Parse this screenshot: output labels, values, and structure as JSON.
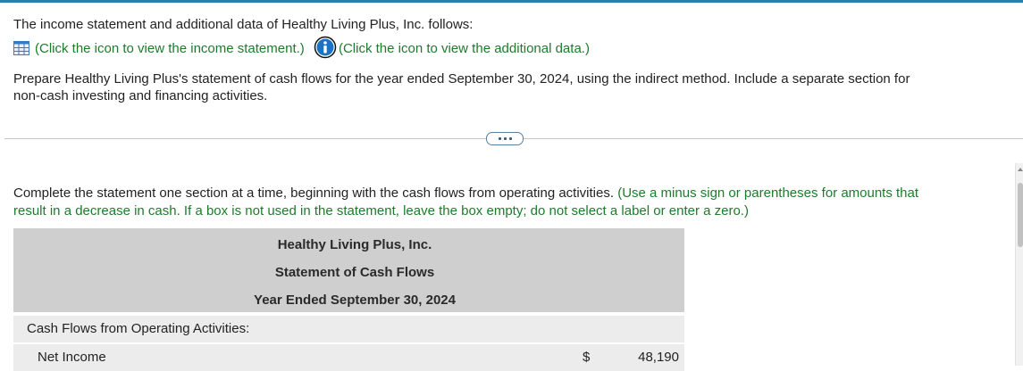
{
  "intro": {
    "text": "The income statement and additional data of Healthy Living Plus, Inc. follows:",
    "link_income_statement": "(Click the icon to view the income statement.)",
    "link_additional_data": "(Click the icon to view the additional data.)"
  },
  "instructions": {
    "line1": "Prepare Healthy Living Plus's statement of cash flows for the year ended September 30, 2024, using the indirect method. Include a separate section for",
    "line2": "non-cash investing and financing activities."
  },
  "complete": {
    "line1_black": "Complete the statement one section at a time, beginning with the cash flows from operating activities.",
    "line1_green": "(Use a minus sign or parentheses for amounts that",
    "line2_green": "result in a decrease in cash. If a box is not used in the statement, leave the box empty; do not select a label or enter a zero.)"
  },
  "statement": {
    "company": "Healthy Living Plus, Inc.",
    "title": "Statement of Cash Flows",
    "period": "Year Ended September 30, 2024",
    "section_operating": "Cash Flows from Operating Activities:",
    "net_income_label": "Net Income",
    "currency": "$",
    "net_income_value": "48,190"
  },
  "icons": {
    "table": "table-grid-icon",
    "info": "info-icon",
    "more": "ellipsis-icon"
  },
  "colors": {
    "green_text": "#1e7b2c",
    "header_bg": "#cfcfcf",
    "row_bg": "#ececec",
    "info_blue": "#1a73c9"
  }
}
